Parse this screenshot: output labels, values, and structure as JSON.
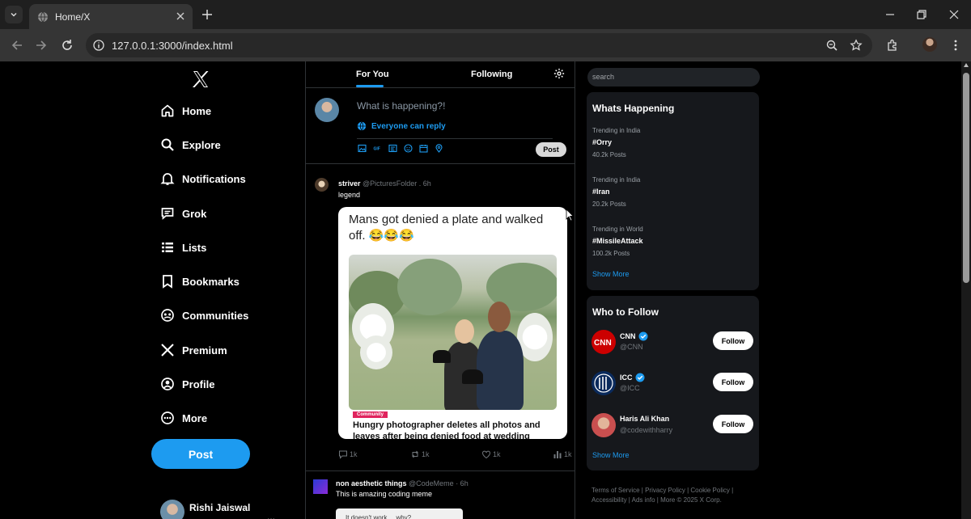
{
  "browser": {
    "tab_title": "Home/X",
    "url": "127.0.0.1:3000/index.html"
  },
  "nav": {
    "items": [
      {
        "label": "Home",
        "icon": "home-icon"
      },
      {
        "label": "Explore",
        "icon": "search-icon"
      },
      {
        "label": "Notifications",
        "icon": "bell-icon"
      },
      {
        "label": "Grok",
        "icon": "grok-icon"
      },
      {
        "label": "Lists",
        "icon": "list-icon"
      },
      {
        "label": "Bookmarks",
        "icon": "bookmark-icon"
      },
      {
        "label": "Communities",
        "icon": "communities-icon"
      },
      {
        "label": "Premium",
        "icon": "x-icon"
      },
      {
        "label": "Profile",
        "icon": "profile-icon"
      },
      {
        "label": "More",
        "icon": "more-icon"
      }
    ],
    "post_label": "Post",
    "account_name": "Rishi Jaiswal",
    "account_more": "..."
  },
  "feed": {
    "tabs": [
      "For You",
      "Following"
    ],
    "composer": {
      "placeholder": "What is happening?!",
      "reply_setting": "Everyone can reply",
      "post_label": "Post"
    },
    "tweets": [
      {
        "name": "striver",
        "handle": "@PicturesFolder . 6h",
        "text": "legend",
        "media_caption": "Mans got denied a plate and walked off. 😂😂😂",
        "media_tag": "Community",
        "media_headline": "Hungry photographer deletes all photos and leaves after being denied food at wedding",
        "comments": "1k",
        "retweets": "1k",
        "likes": "1k",
        "views": "1k"
      },
      {
        "name": "non aesthetic things",
        "handle": "@CodeMeme · 6h",
        "text": "This is amazing coding meme",
        "media_text": "It doesn't work ... why?"
      }
    ]
  },
  "sidebar": {
    "search_placeholder": "search",
    "happening_title": "Whats Happening",
    "trends": [
      {
        "context": "Trending in India",
        "name": "#Orry",
        "count": "40.2k Posts"
      },
      {
        "context": "Trending in India",
        "name": "#Iran",
        "count": "20.2k Posts"
      },
      {
        "context": "Trending in World",
        "name": "#MissileAttack",
        "count": "100.2k Posts"
      }
    ],
    "show_more": "Show More",
    "follow_title": "Who to Follow",
    "follow": [
      {
        "name": "CNN",
        "handle": "@CNN",
        "verified": true,
        "button": "Follow"
      },
      {
        "name": "ICC",
        "handle": "@ICC",
        "verified": true,
        "button": "Follow"
      },
      {
        "name": "Haris Ali Khan",
        "handle": "@codewithharry",
        "verified": false,
        "button": "Follow"
      }
    ],
    "show_more_follow": "Show More",
    "footer": "Terms of Service | Privacy Policy | Cookie Policy | Accessibility | Ads info | More © 2025 X Corp."
  },
  "colors": {
    "accent": "#1d9bf0",
    "background": "#000000",
    "panel": "#16181c"
  }
}
